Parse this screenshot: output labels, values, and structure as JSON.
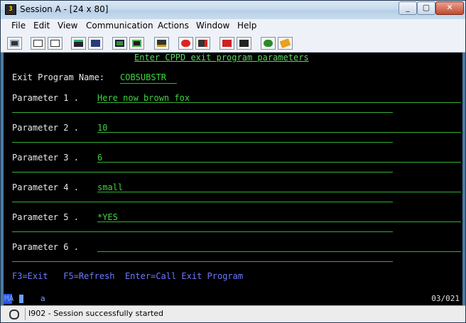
{
  "window": {
    "title": "Session A - [24 x 80]"
  },
  "menu": [
    "File",
    "Edit",
    "View",
    "Communication",
    "Actions",
    "Window",
    "Help"
  ],
  "screen": {
    "header": "Enter CPPD exit program parameters",
    "exit_program_label": "Exit Program Name:",
    "exit_program_value": "COBSUBSTR",
    "parameters": [
      {
        "label": "Parameter 1 .",
        "value": "Here now brown fox"
      },
      {
        "label": "Parameter 2 .",
        "value": "10"
      },
      {
        "label": "Parameter 3 .",
        "value": "6"
      },
      {
        "label": "Parameter 4 .",
        "value": "small"
      },
      {
        "label": "Parameter 5 .",
        "value": "*YES"
      },
      {
        "label": "Parameter 6 .",
        "value": ""
      }
    ],
    "function_keys": "F3=Exit   F5=Refresh  Enter=Call Exit Program"
  },
  "oia": {
    "mode": "MA",
    "indicator": "a",
    "cursor_pos": "03/021"
  },
  "status": {
    "message": "I902 - Session successfully started"
  }
}
